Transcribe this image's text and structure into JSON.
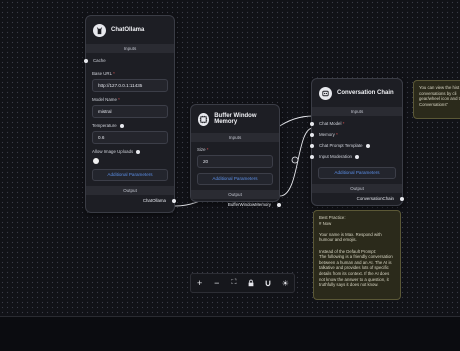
{
  "chat_ollama": {
    "title": "ChatOllama",
    "inputs_label": "Inputs",
    "cache_label": "Cache",
    "base_url_label": "Base URL",
    "base_url_value": "http://127.0.0.1:11435",
    "model_name_label": "Model Name",
    "model_name_value": "mistral",
    "temperature_label": "Temperature",
    "temperature_value": "0.6",
    "allow_image_label": "Allow Image Uploads",
    "additional_params": "Additional Parameters",
    "output_label": "Output",
    "output_port": "ChatOllama",
    "required_mark": "*"
  },
  "buffer_memory": {
    "title": "Buffer Window Memory",
    "inputs_label": "Inputs",
    "size_label": "Size",
    "size_value": "20",
    "additional_params": "Additional Parameters",
    "output_label": "Output",
    "output_port": "BufferWindowMemory",
    "required_mark": "*"
  },
  "conversation_chain": {
    "title": "Conversation Chain",
    "inputs_label": "Inputs",
    "chat_model_label": "Chat Model",
    "memory_label": "Memory",
    "chat_prompt_label": "Chat Prompt Template",
    "input_moderation_label": "Input Moderation",
    "additional_params": "Additional Parameters",
    "output_label": "Output",
    "output_port": "ConversationChain",
    "required_mark": "*"
  },
  "sticky_note": {
    "text": "Best Practice:\n# Now\n\nYour name is Max. Respond with humour and emojis.\n\nInstead of the Default Prompt:\nThe following is a friendly conversation between a human and an AI. The AI is talkative and provides lots of specific details from its context. If the AI does not know the answer to a question, it truthfully says it does not know."
  },
  "hint_note": {
    "text": "You can view the hist\nconversations by cli\ngear/wheel icon and th\nConversations\""
  },
  "toolbar": {
    "zoom_in": "+",
    "zoom_out": "−",
    "fit_view": "⛶",
    "lock": "🔒",
    "snap": "◫",
    "theme": "☀"
  },
  "colors": {
    "canvas": "#111217",
    "node": "#1d1e24",
    "accent": "#5b8ee6",
    "required": "#e05252",
    "note": "#2b2a1b"
  }
}
